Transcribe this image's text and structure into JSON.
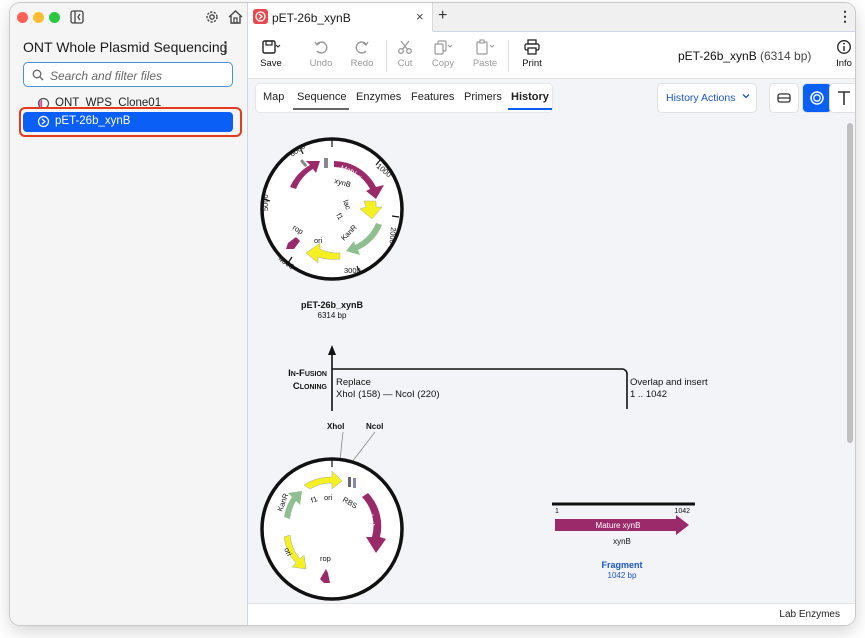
{
  "sidebar": {
    "project_title": "ONT Whole Plasmid Sequencing",
    "search_placeholder": "Search and filter files",
    "files": [
      {
        "label": "ONT_WPS_Clone01"
      },
      {
        "label": "pET-26b_xynB",
        "selected": true
      }
    ]
  },
  "tab": {
    "label": "pET-26b_xynB",
    "close": "×",
    "add": "+",
    "more": "⋮"
  },
  "toolbar": {
    "save": "Save",
    "undo": "Undo",
    "redo": "Redo",
    "cut": "Cut",
    "copy": "Copy",
    "paste": "Paste",
    "print": "Print",
    "info": "Info",
    "doc_name": "pET-26b_xynB",
    "doc_length": "(6314 bp)"
  },
  "view_tabs": [
    "Map",
    "Sequence",
    "Enzymes",
    "Features",
    "Primers",
    "History"
  ],
  "active_tab": "History",
  "history_actions": "History Actions",
  "canvas": {
    "top_map": {
      "name": "pET-26b_xynB",
      "length": "6314 bp",
      "ticks": [
        "1000",
        "2000",
        "3000",
        "4000",
        "5000",
        "6000"
      ],
      "features": [
        "Matu...",
        "xynB",
        "lacI",
        "lac",
        "f1",
        "ori",
        "KanR",
        "ori",
        "rop"
      ]
    },
    "operation": {
      "title_line1": "In-Fusion",
      "title_line2": "Cloning",
      "replace_label": "Replace",
      "replace_detail": "XhoI (158)  —  NcoI (220)",
      "overlap_label": "Overlap and insert",
      "overlap_detail": "1 .. 1042"
    },
    "bottom_map": {
      "sites": [
        "XhoI",
        "NcoI"
      ],
      "features": [
        "KanR",
        "f1",
        "ori",
        "RBS",
        "lacI",
        "ori",
        "rop"
      ]
    },
    "fragment": {
      "start": "1",
      "end": "1042",
      "feature": "Mature xynB",
      "gene": "xynB",
      "title": "Fragment",
      "length": "1042 bp"
    }
  },
  "status": "Lab Enzymes",
  "colors": {
    "accent": "#0a60f6",
    "highlight": "#e23a1e",
    "feature_purple": "#9b2a6a",
    "feature_yellow": "#f4f021",
    "feature_green": "#8fbf8f",
    "fragment_title": "#1a55c8"
  }
}
